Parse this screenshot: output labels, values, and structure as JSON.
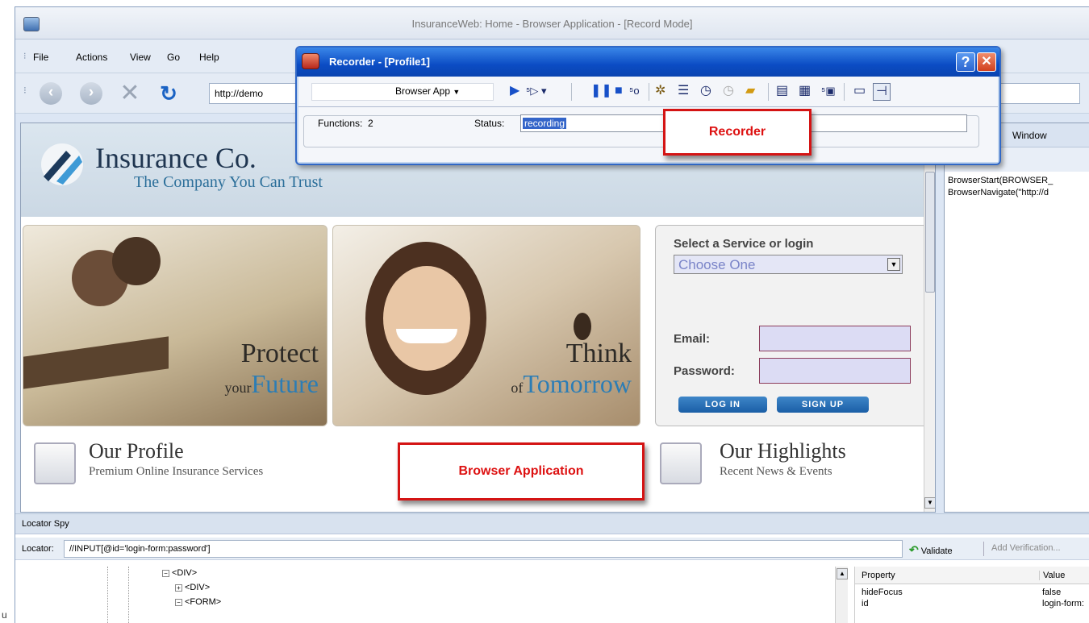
{
  "window": {
    "title": "InsuranceWeb: Home - Browser Application - [Record Mode]"
  },
  "menu": [
    "File",
    "Actions",
    "View",
    "Go",
    "Help"
  ],
  "nav": {
    "url": "http://demo",
    "icons": [
      "back-icon",
      "forward-icon",
      "stop-icon",
      "refresh-icon"
    ]
  },
  "site": {
    "brand": "Insurance Co.",
    "tagline": "The Company You Can Trust",
    "panel1": {
      "line1": "Protect",
      "line2_small": "your",
      "line2_big": "Future"
    },
    "panel2": {
      "line1": "Think",
      "line2_small": "of",
      "line2_big": "Tomorrow"
    },
    "service": {
      "title": "Select a Service or login",
      "select_value": "Choose One",
      "email_label": "Email:",
      "password_label": "Password:",
      "login_label": "LOG IN",
      "signup_label": "SIGN UP"
    },
    "profile": {
      "title": "Our Profile",
      "subtitle": "Premium Online Insurance Services"
    },
    "highlights": {
      "title": "Our Highlights",
      "subtitle": "Recent News & Events"
    }
  },
  "right_panel": {
    "title": "Window",
    "code": [
      "BrowserStart(BROWSER_",
      "BrowserNavigate(\"http://d"
    ]
  },
  "recorder": {
    "title": "Recorder - [Profile1]",
    "help_label": "?",
    "close_label": "✕",
    "app_select": "Browser App",
    "functions_label": "Functions:",
    "functions_value": "2",
    "status_label": "Status:",
    "status_value": "recording"
  },
  "callouts": {
    "recorder": "Recorder",
    "browser": "Browser Application"
  },
  "spy": {
    "title": "Locator Spy",
    "locator_label": "Locator:",
    "locator_value": "//INPUT[@id='login-form:password']",
    "validate_label": "Validate",
    "add_verification_label": "Add Verification...",
    "tree": [
      "<DIV>",
      "<DIV>",
      "<FORM>"
    ],
    "props_header": {
      "property": "Property",
      "value": "Value"
    },
    "props": [
      {
        "property": "hideFocus",
        "value": "false"
      },
      {
        "property": "id",
        "value": "login-form:"
      }
    ]
  },
  "edge_letter": "u",
  "colors": {
    "accent": "#0b4cc4",
    "callout_red": "#d41414",
    "status_highlight": "#3465c9"
  }
}
